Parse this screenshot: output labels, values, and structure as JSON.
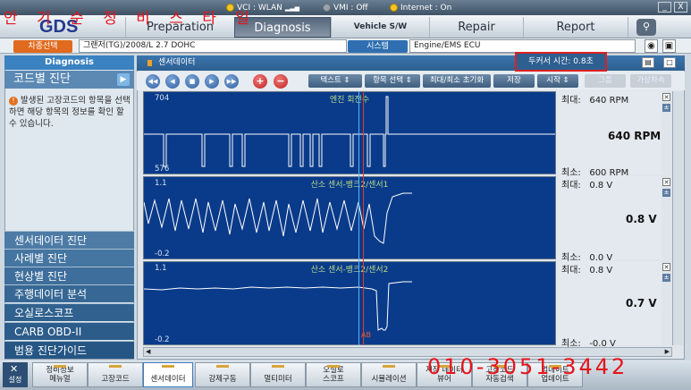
{
  "status": {
    "vci": "VCI : WLAN",
    "vmi": "VMI : Off",
    "internet": "Internet : On"
  },
  "window": {
    "minimize": "_",
    "close": "X"
  },
  "logo": {
    "text": "GDS"
  },
  "nav": {
    "tabs": [
      {
        "label": "Preparation"
      },
      {
        "label": "Diagnosis"
      },
      {
        "label": "Vehicle S/W Management"
      },
      {
        "label": "Repair"
      },
      {
        "label": "Report"
      }
    ]
  },
  "vehicle": {
    "select_label": "차종선택",
    "model": "그랜저(TG)/2008/L 2.7 DOHC",
    "system_label": "시스템",
    "system_value": "Engine/EMS ECU"
  },
  "sidebar": {
    "title": "Diagnosis",
    "selected": "코드별 진단",
    "message": "발생된 고장코드의 항목을 선택하면 해당 항목의 정보를 확인 할 수 있습니다.",
    "items": [
      {
        "label": "센서데이터 진단"
      },
      {
        "label": "사례별 진단"
      },
      {
        "label": "현상별 진단"
      },
      {
        "label": "주행데이터 분석"
      },
      {
        "label": "오실로스코프"
      },
      {
        "label": "CARB OBD-II"
      },
      {
        "label": "범용 진단가이드"
      }
    ]
  },
  "main": {
    "title": "센서데이터",
    "cursor_time": "두커서 시간: 0.8초"
  },
  "toolbar": {
    "text_btn": "텍스트",
    "select_btn": "항목 선택",
    "reset_btn": "최대/최소 초기화",
    "save_btn": "저장",
    "start_btn": "시작",
    "group_btn": "그룹",
    "virtual_btn": "가상차속"
  },
  "graphs": [
    {
      "name": "엔진 회전수",
      "ymax_label": "704",
      "ymin_label": "576",
      "max_label": "최대:",
      "max_value": "640 RPM",
      "min_label": "최소:",
      "min_value": "600 RPM",
      "current": "640 RPM"
    },
    {
      "name": "산소 센서-뱅크2/센서1",
      "ymax_label": "1.1",
      "ymin_label": "-0.2",
      "max_label": "최대:",
      "max_value": "0.8 V",
      "min_label": "최소:",
      "min_value": "0.0 V",
      "current": "0.8 V"
    },
    {
      "name": "산소 센서-뱅크2/센서2",
      "ymax_label": "1.1",
      "ymin_label": "-0.2",
      "max_label": "최대:",
      "max_value": "0.8 V",
      "min_label": "최소:",
      "min_value": "-0.0 V",
      "current": "0.7 V",
      "cursor_label": "AB"
    }
  ],
  "bottom": {
    "settings": "설정",
    "buttons": [
      {
        "label": "정비정보\n메뉴얼"
      },
      {
        "label": "고장코드"
      },
      {
        "label": "센서데이터"
      },
      {
        "label": "강제구동"
      },
      {
        "label": "멀티미터"
      },
      {
        "label": "오실로\n스코프"
      },
      {
        "label": "시뮬레이션"
      },
      {
        "label": "저장 데이터\n뷰어"
      },
      {
        "label": "고장코드\n자동검색"
      },
      {
        "label": "업데이트\n업데이트"
      }
    ]
  },
  "handwriting": {
    "top": "안 기 순 정 비 스 타 일",
    "bottom": "010-3051-3442"
  }
}
